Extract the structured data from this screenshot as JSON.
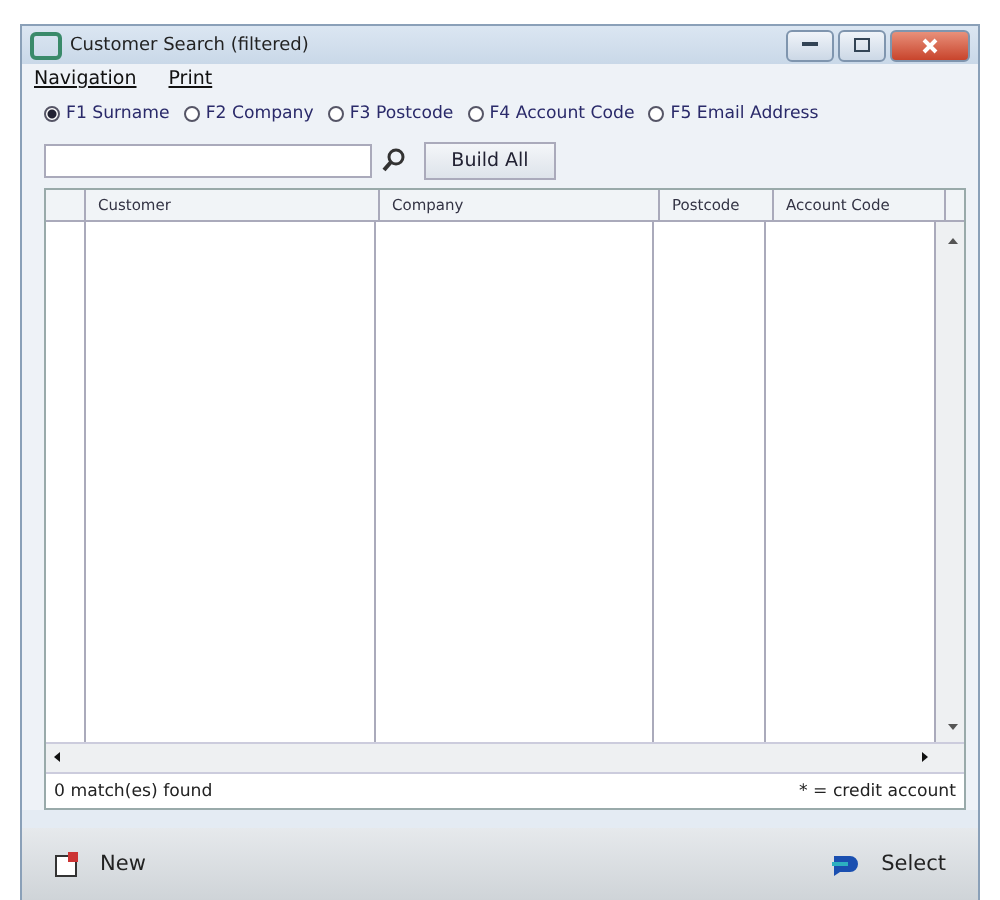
{
  "window": {
    "title": "Customer Search (filtered)"
  },
  "menu": [
    {
      "label": "Navigation"
    },
    {
      "label": "Print"
    }
  ],
  "search_modes": [
    {
      "label": "F1 Surname",
      "selected": true
    },
    {
      "label": "F2 Company",
      "selected": false
    },
    {
      "label": "F3 Postcode",
      "selected": false
    },
    {
      "label": "F4 Account Code",
      "selected": false
    },
    {
      "label": "F5 Email Address",
      "selected": false
    }
  ],
  "build_button": "Build All",
  "table": {
    "columns": [
      "Customer",
      "Company",
      "Postcode",
      "Account Code"
    ]
  },
  "status": {
    "matches": "0 match(es) found",
    "legend": "* = credit account"
  },
  "buttons": {
    "new": "New",
    "select": "Select"
  }
}
